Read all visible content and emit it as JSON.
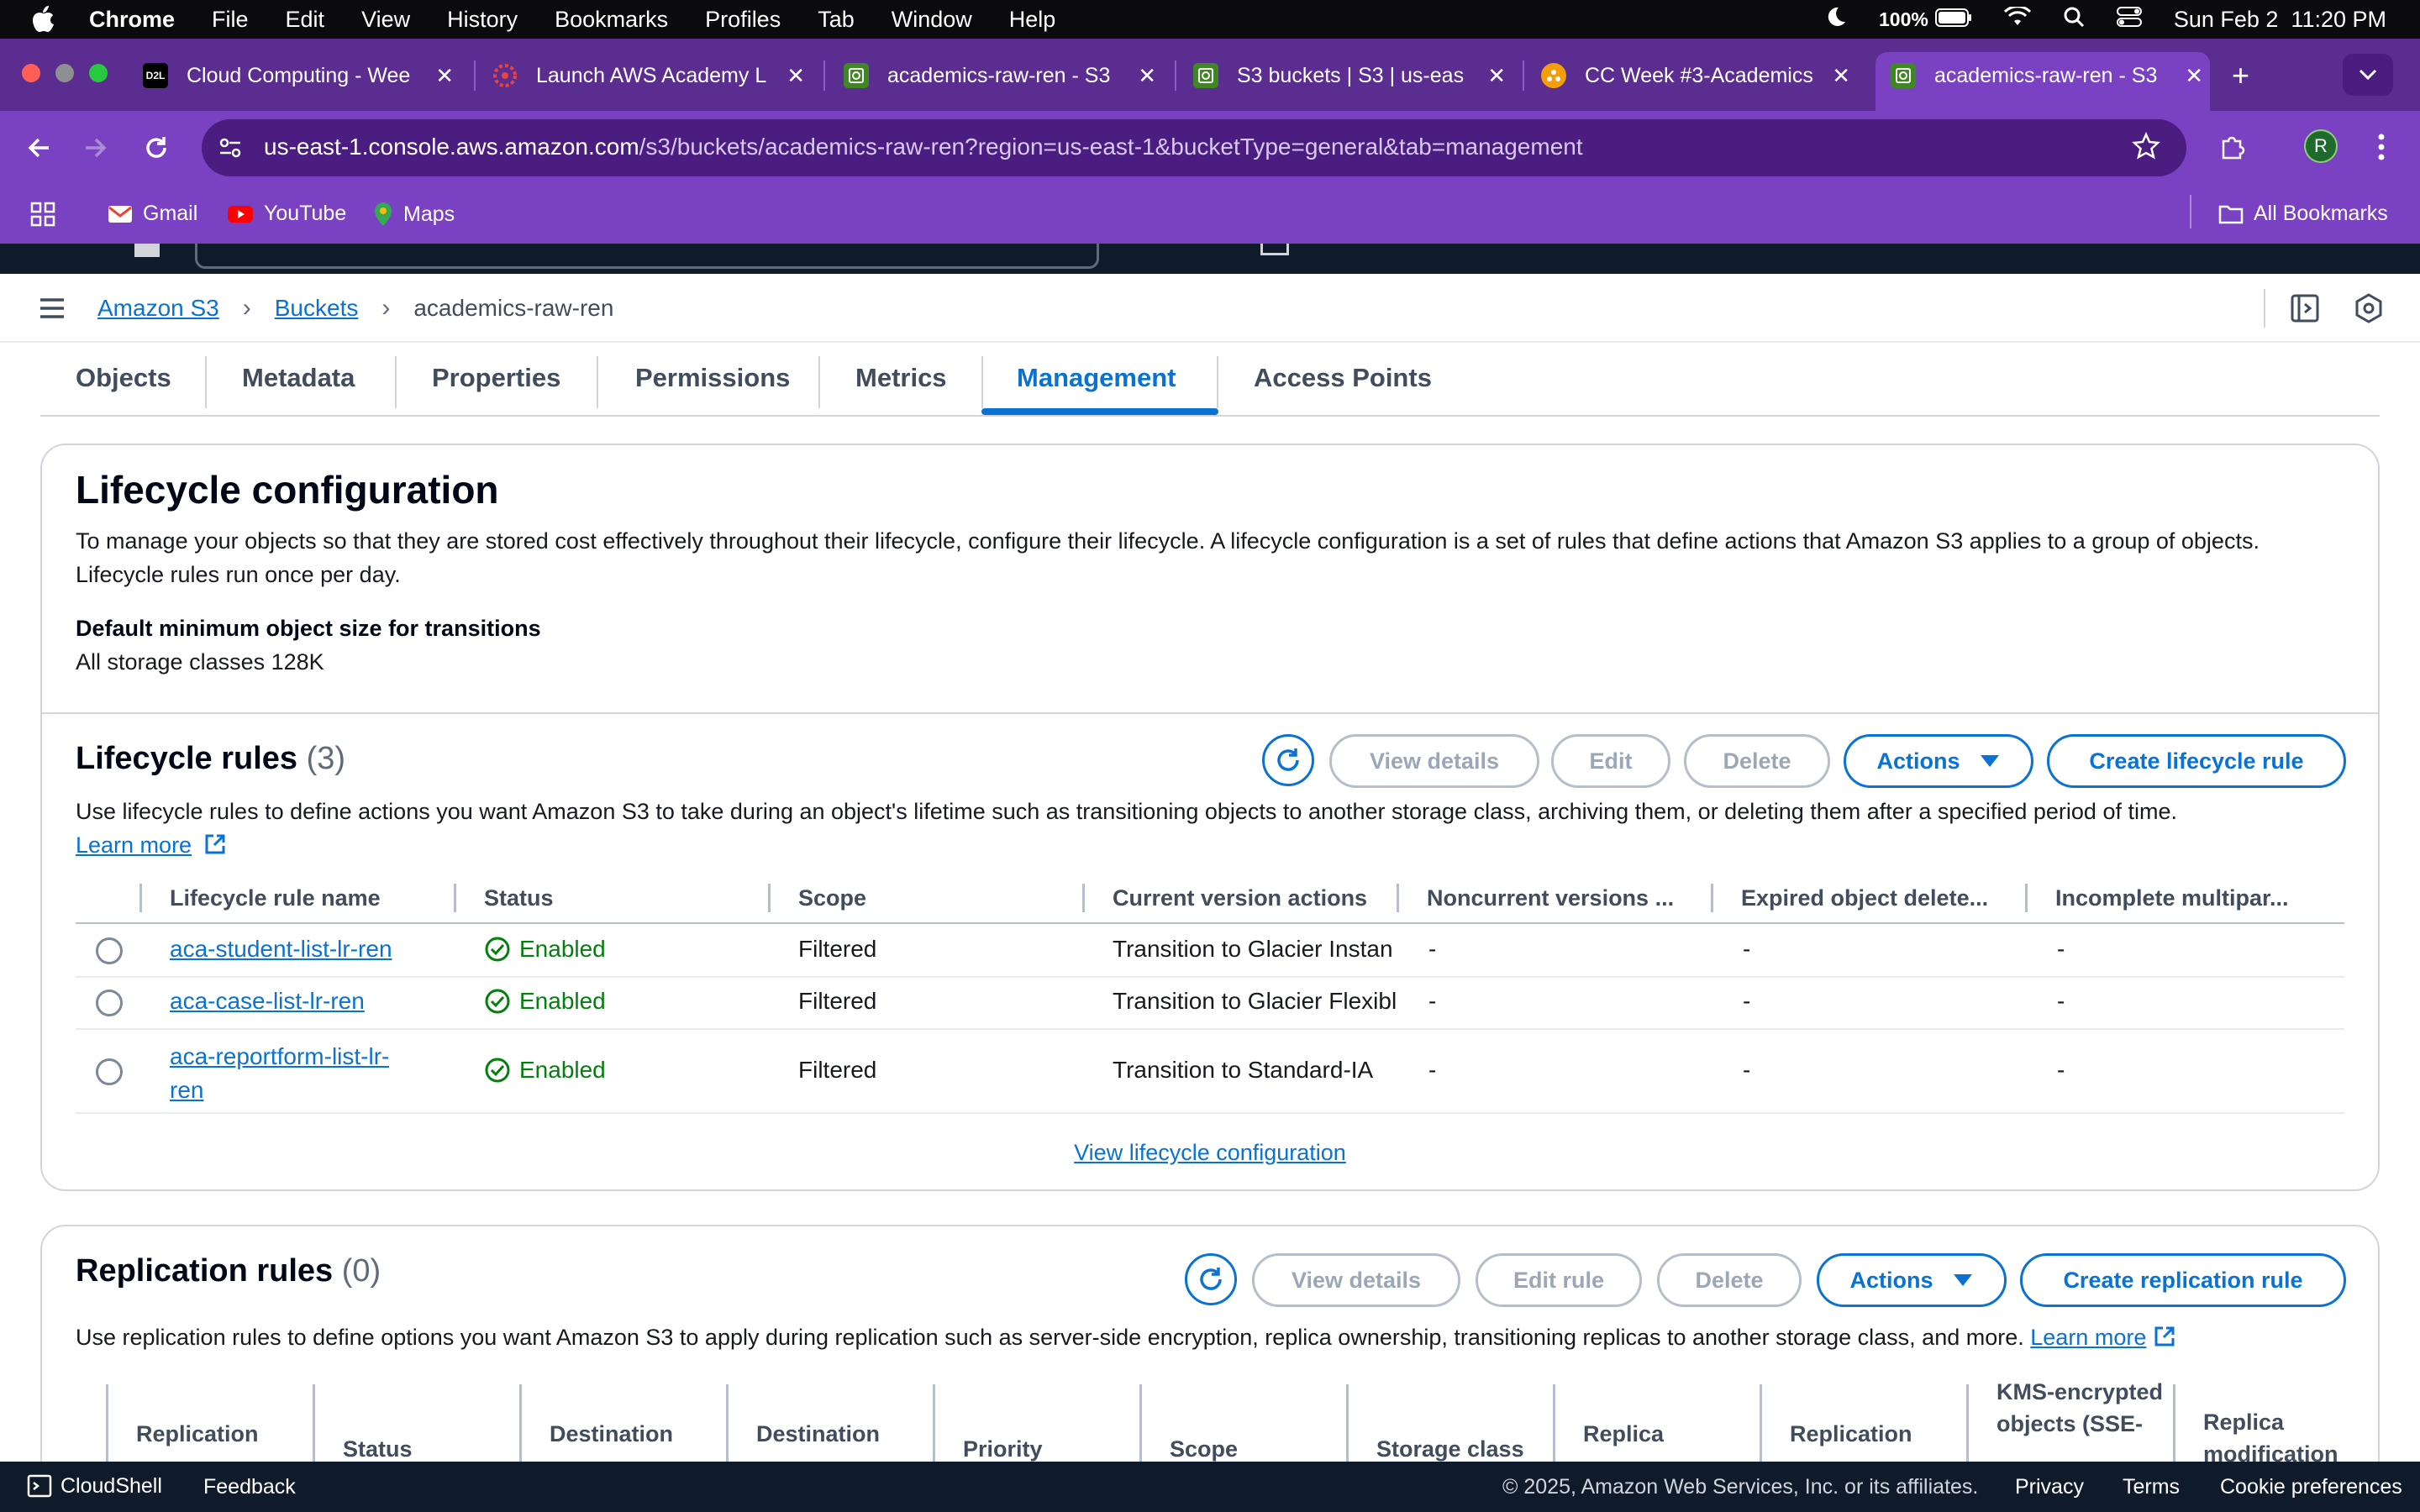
{
  "macos": {
    "app_name": "Chrome",
    "menus": [
      "File",
      "Edit",
      "View",
      "History",
      "Bookmarks",
      "Profiles",
      "Tab",
      "Window",
      "Help"
    ],
    "battery": "100%",
    "datetime": "Sun Feb 2  11:20 PM"
  },
  "browser": {
    "tabs": [
      {
        "title": "Cloud Computing - Wee",
        "favicon": "D2L"
      },
      {
        "title": "Launch AWS Academy L",
        "favicon": ""
      },
      {
        "title": "academics-raw-ren - S3",
        "favicon": ""
      },
      {
        "title": "S3 buckets | S3 | us-eas",
        "favicon": ""
      },
      {
        "title": "CC Week #3-Academics",
        "favicon": ""
      },
      {
        "title": "academics-raw-ren - S3",
        "favicon": ""
      }
    ],
    "url_host": "us-east-1.console.aws.amazon.com",
    "url_path": "/s3/buckets/academics-raw-ren?region=us-east-1&bucketType=general&tab=management",
    "profile_initial": "R",
    "bookmarks": [
      "Gmail",
      "YouTube",
      "Maps"
    ],
    "all_bookmarks": "All Bookmarks"
  },
  "breadcrumb": {
    "root": "Amazon S3",
    "buckets": "Buckets",
    "current": "academics-raw-ren"
  },
  "bucket_tabs": [
    "Objects",
    "Metadata",
    "Properties",
    "Permissions",
    "Metrics",
    "Management",
    "Access Points"
  ],
  "lifecycle_config": {
    "title": "Lifecycle configuration",
    "description": "To manage your objects so that they are stored cost effectively throughout their lifecycle, configure their lifecycle. A lifecycle configuration is a set of rules that define actions that Amazon S3 applies to a group of objects. Lifecycle rules run once per day.",
    "min_size_label": "Default minimum object size for transitions",
    "min_size_value": "All storage classes 128K"
  },
  "lifecycle_rules": {
    "title": "Lifecycle rules",
    "count": "(3)",
    "description": "Use lifecycle rules to define actions you want Amazon S3 to take during an object's lifetime such as transitioning objects to another storage class, archiving them, or deleting them after a specified period of time.",
    "learn_more": "Learn more",
    "buttons": {
      "view_details": "View details",
      "edit": "Edit",
      "delete": "Delete",
      "actions": "Actions",
      "create": "Create lifecycle rule"
    },
    "columns": [
      "Lifecycle rule name",
      "Status",
      "Scope",
      "Current version actions",
      "Noncurrent versions ...",
      "Expired object delete...",
      "Incomplete multipar..."
    ],
    "rows": [
      {
        "name": "aca-student-list-lr-ren",
        "status": "Enabled",
        "scope": "Filtered",
        "current": "Transition to Glacier Instan",
        "noncurrent": "-",
        "expired": "-",
        "incomplete": "-"
      },
      {
        "name": "aca-case-list-lr-ren",
        "status": "Enabled",
        "scope": "Filtered",
        "current": "Transition to Glacier Flexibl",
        "noncurrent": "-",
        "expired": "-",
        "incomplete": "-"
      },
      {
        "name_line1": "aca-reportform-list-lr-",
        "name_line2": "ren",
        "status": "Enabled",
        "scope": "Filtered",
        "current": "Transition to Standard-IA",
        "noncurrent": "-",
        "expired": "-",
        "incomplete": "-"
      }
    ],
    "view_config": "View lifecycle configuration"
  },
  "replication_rules": {
    "title": "Replication rules",
    "count": "(0)",
    "description": "Use replication rules to define options you want Amazon S3 to apply during replication such as server-side encryption, replica ownership, transitioning replicas to another storage class, and more.",
    "learn_more": "Learn more",
    "buttons": {
      "view_details": "View details",
      "edit_rule": "Edit rule",
      "delete": "Delete",
      "actions": "Actions",
      "create": "Create replication rule"
    },
    "columns": [
      "Replication",
      "Status",
      "Destination",
      "Destination",
      "Priority",
      "Scope",
      "Storage class",
      "Replica",
      "Replication",
      "KMS-encrypted objects (SSE-",
      "Replica modification"
    ]
  },
  "footer": {
    "cloudshell": "CloudShell",
    "feedback": "Feedback",
    "copyright": "© 2025, Amazon Web Services, Inc. or its affiliates.",
    "privacy": "Privacy",
    "terms": "Terms",
    "cookies": "Cookie preferences"
  },
  "colors": {
    "accent": "#0972d3",
    "chrome_purple": "#7a42c2",
    "success": "#037f0c"
  }
}
